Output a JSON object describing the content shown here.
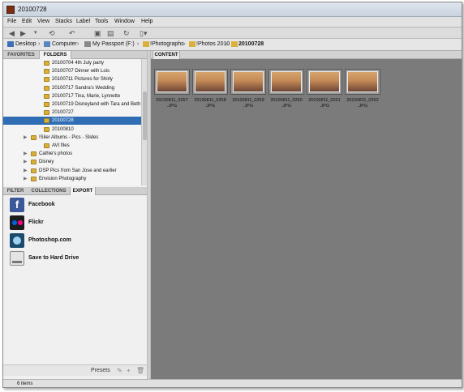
{
  "window": {
    "title": "20100728"
  },
  "menu": [
    "File",
    "Edit",
    "View",
    "Stacks",
    "Label",
    "Tools",
    "Window",
    "Help"
  ],
  "path": [
    {
      "label": "Desktop",
      "icon": "desktop-icon"
    },
    {
      "label": "Computer",
      "icon": "computer-icon"
    },
    {
      "label": "My Passport (F:)",
      "icon": "drive-icon"
    },
    {
      "label": "!Photographs",
      "icon": "folder-icon"
    },
    {
      "label": "!Photos 2010",
      "icon": "folder-icon"
    },
    {
      "label": "20100728",
      "icon": "folder-icon"
    }
  ],
  "left_tabs": [
    "FAVORITES",
    "FOLDERS"
  ],
  "folders": [
    {
      "label": "20100704 4th July party",
      "expander": false,
      "selected": false
    },
    {
      "label": "20100707 Dinner with Lois",
      "expander": false,
      "selected": false
    },
    {
      "label": "20100711 Pictures for Shirly",
      "expander": false,
      "selected": false
    },
    {
      "label": "20100717 Sandra's Wedding",
      "expander": false,
      "selected": false
    },
    {
      "label": "20100717 Tina, Marie, Lynnette",
      "expander": false,
      "selected": false
    },
    {
      "label": "20100719 Disneyland with Tara and Beth",
      "expander": false,
      "selected": false
    },
    {
      "label": "20100727",
      "expander": false,
      "selected": false
    },
    {
      "label": "20100728",
      "expander": false,
      "selected": true
    },
    {
      "label": "20100810",
      "expander": false,
      "selected": false
    },
    {
      "label": "!Siler Albums - Pics - Slides",
      "expander": true,
      "selected": false
    },
    {
      "label": "AVI files",
      "expander": false,
      "selected": false
    },
    {
      "label": "Cathie's photos",
      "expander": true,
      "selected": false
    },
    {
      "label": "Disney",
      "expander": true,
      "selected": false
    },
    {
      "label": "DSP Pics from San Jose and earlier",
      "expander": true,
      "selected": false
    },
    {
      "label": "Envision Photography",
      "expander": true,
      "selected": false
    }
  ],
  "bottom_tabs": [
    "FILTER",
    "COLLECTIONS",
    "EXPORT"
  ],
  "export_items": [
    {
      "label": "Facebook",
      "icon": "facebook-icon",
      "color": "#3b5998"
    },
    {
      "label": "Flickr",
      "icon": "flickr-icon",
      "color": "#1c1c1c"
    },
    {
      "label": "Photoshop.com",
      "icon": "photoshop-icon",
      "color": "#1a4a6e"
    },
    {
      "label": "Save to Hard Drive",
      "icon": "hard-drive-icon",
      "color": "#e4e4e4"
    }
  ],
  "presets_label": "Presets",
  "content_tab": "CONTENT",
  "thumbnails": [
    {
      "name": "20100811_0257",
      "ext": ".JPG"
    },
    {
      "name": "20100811_0258",
      "ext": ".JPG"
    },
    {
      "name": "20100811_0259",
      "ext": ".JPG"
    },
    {
      "name": "20100811_0260",
      "ext": ".JPG"
    },
    {
      "name": "20100811_0261",
      "ext": ".JPG"
    },
    {
      "name": "20100811_0262",
      "ext": ".JPG"
    }
  ],
  "status": "6 items"
}
